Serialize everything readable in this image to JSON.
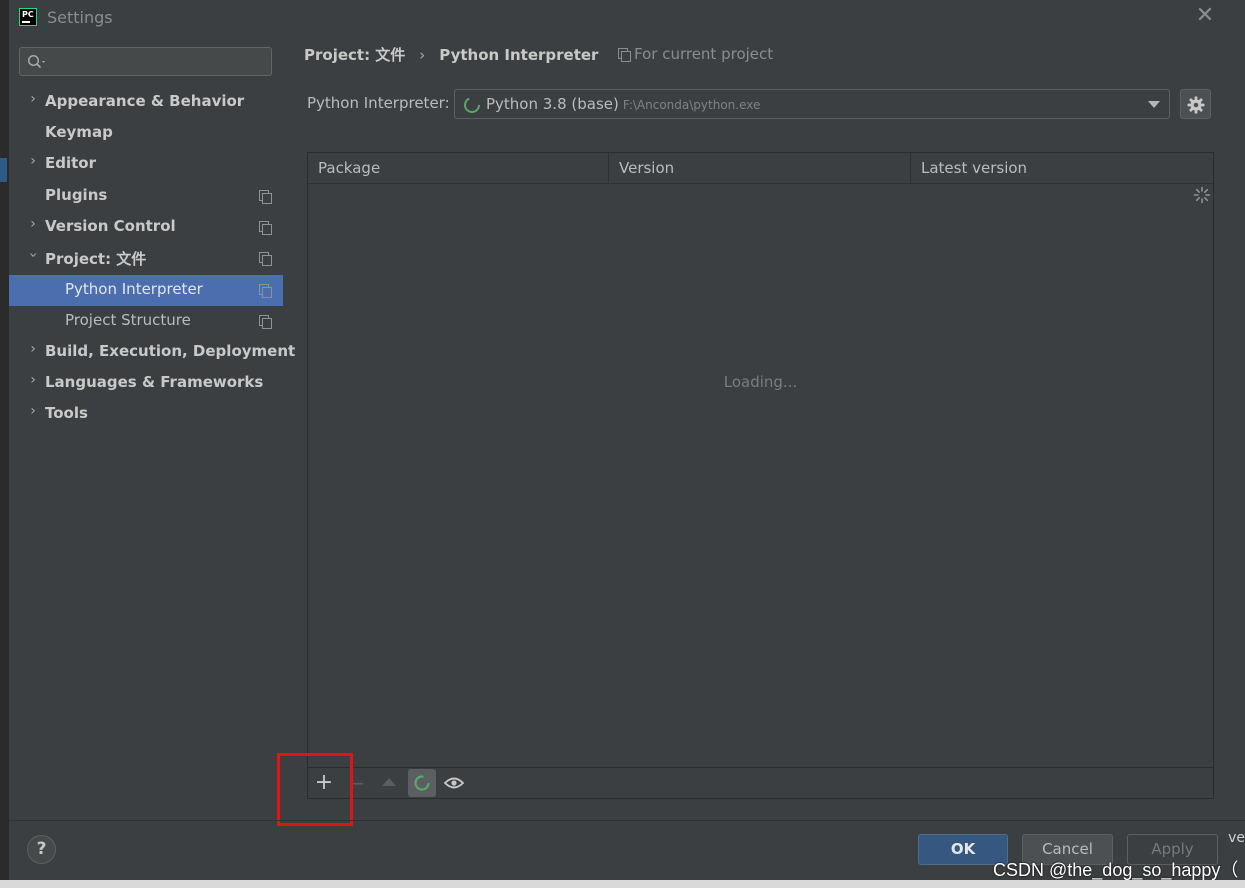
{
  "window": {
    "title": "Settings",
    "app_icon_text": "PC",
    "close_glyph": "✕"
  },
  "sidebar": {
    "search_placeholder": "",
    "items": [
      {
        "label": "Appearance & Behavior",
        "expandable": true,
        "expanded": false,
        "copy_icon": false
      },
      {
        "label": "Keymap",
        "expandable": false,
        "copy_icon": false
      },
      {
        "label": "Editor",
        "expandable": true,
        "expanded": false,
        "copy_icon": false
      },
      {
        "label": "Plugins",
        "expandable": false,
        "copy_icon": true
      },
      {
        "label": "Version Control",
        "expandable": true,
        "expanded": false,
        "copy_icon": true
      },
      {
        "label": "Project: 文件",
        "expandable": true,
        "expanded": true,
        "copy_icon": true
      },
      {
        "label": "Python Interpreter",
        "child": true,
        "selected": true,
        "copy_icon": true
      },
      {
        "label": "Project Structure",
        "child": true,
        "copy_icon": true
      },
      {
        "label": "Build, Execution, Deployment",
        "expandable": true,
        "expanded": false,
        "copy_icon": false
      },
      {
        "label": "Languages & Frameworks",
        "expandable": true,
        "expanded": false,
        "copy_icon": false
      },
      {
        "label": "Tools",
        "expandable": true,
        "expanded": false,
        "copy_icon": false
      }
    ]
  },
  "header": {
    "breadcrumb": [
      "Project: 文件",
      "Python Interpreter"
    ],
    "breadcrumb_separator": "›",
    "scope_label": "For current project"
  },
  "interpreter": {
    "label": "Python Interpreter:",
    "selected_name": "Python 3.8 (base)",
    "selected_path": "F:\\Anconda\\python.exe"
  },
  "packages_table": {
    "columns": [
      "Package",
      "Version",
      "Latest version"
    ],
    "rows": [],
    "status_text": "Loading..."
  },
  "toolbar": {
    "add_glyph": "+",
    "remove_glyph": "−"
  },
  "footer": {
    "help_label": "?",
    "ok_label": "OK",
    "cancel_label": "Cancel",
    "apply_label": "Apply"
  },
  "overlay": {
    "watermark": "CSDN @the_dog_so_happy（",
    "right_edge_text": "ve"
  },
  "colors": {
    "background": "#3c3f41",
    "selection": "#4b6eaf",
    "ok_button": "#365880",
    "spinner_green": "#59a869",
    "highlight_box": "#e01616"
  }
}
